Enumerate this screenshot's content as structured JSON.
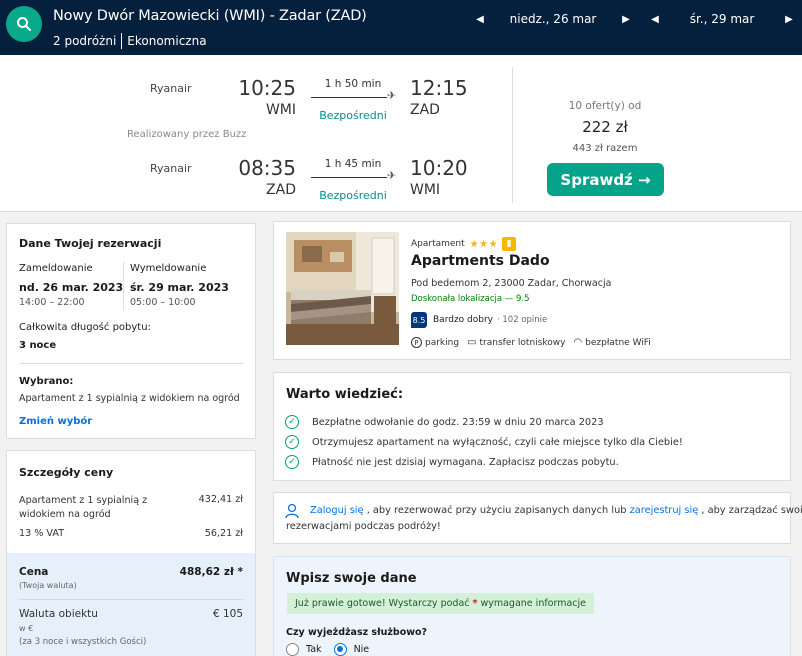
{
  "header": {
    "route": "Nowy Dwór Mazowiecki (WMI) - Zadar (ZAD)",
    "travellers": "2 podróżni",
    "cabin": "Ekonomiczna",
    "depart_date": "niedz., 26 mar",
    "return_date": "śr., 29 mar"
  },
  "flights": {
    "outbound": {
      "airline": "Ryanair",
      "dep_time": "10:25",
      "dep_code": "WMI",
      "duration": "1 h 50 min",
      "stops": "Bezpośredni",
      "arr_time": "12:15",
      "arr_code": "ZAD"
    },
    "operated_by": "Realizowany przez Buzz",
    "inbound": {
      "airline": "Ryanair",
      "dep_time": "08:35",
      "dep_code": "ZAD",
      "duration": "1 h 45 min",
      "stops": "Bezpośredni",
      "arr_time": "10:20",
      "arr_code": "WMI"
    },
    "offers": "10 ofert(y) od",
    "price": "222 zł",
    "price_total": "443 zł razem",
    "check_label": "Sprawdź →"
  },
  "reservation": {
    "title": "Dane Twojej rezerwacji",
    "checkin_label": "Zameldowanie",
    "checkin_date": "nd. 26 mar. 2023",
    "checkin_time": "14:00 – 22:00",
    "checkout_label": "Wymeldowanie",
    "checkout_date": "śr. 29 mar. 2023",
    "checkout_time": "05:00 – 10:00",
    "stay_label": "Całkowita długość pobytu:",
    "stay_value": "3 noce",
    "selected_label": "Wybrano:",
    "selected_value": "Apartament z 1 sypialnią z widokiem na ogród",
    "change_link": "Zmień wybór"
  },
  "price_details": {
    "title": "Szczegóły ceny",
    "item_label": "Apartament z 1 sypialnią z widokiem na ogród",
    "item_value": "432,41 zł",
    "vat_label": "13 % VAT",
    "vat_value": "56,21 zł",
    "total_label": "Cena",
    "total_value": "488,62 zł *",
    "total_note": "(Twoja waluta)",
    "property_currency_label": "Waluta obiektu",
    "property_currency_value": "€ 105",
    "property_currency_unit": "w €",
    "property_note": "(za 3 noce i wszystkich Gości)"
  },
  "hotel": {
    "type": "Apartament",
    "stars": "★★★",
    "name": "Apartments Dado",
    "address": "Pod bedemom 2, 23000 Zadar, Chorwacja",
    "location": "Doskonała lokalizacja — 9.5",
    "score": "8.5",
    "score_text": "Bardzo dobry",
    "reviews": "· 102 opinie",
    "amenities": [
      "parking",
      "transfer lotniskowy",
      "bezpłatne WiFi"
    ]
  },
  "good_to_know": {
    "title": "Warto wiedzieć:",
    "items": [
      "Bezpłatne odwołanie do godz. 23:59 w dniu 20 marca 2023",
      "Otrzymujesz apartament na wyłączność, czyli całe miejsce tylko dla Ciebie!",
      "Płatność nie jest dzisiaj wymagana. Zapłacisz podczas pobytu."
    ]
  },
  "login": {
    "link_login": "Zaloguj się",
    "text_middle": ", aby rezerwować przy użyciu zapisanych danych lub",
    "link_register": "zarejestruj się",
    "text_end": ", aby zarządzać swoimi",
    "text_line2": "rezerwacjami podczas podróży!"
  },
  "form": {
    "title": "Wpisz swoje dane",
    "notice_pre": "Już prawie gotowe! Wystarczy podać",
    "notice_star": "*",
    "notice_post": "wymagane informacje",
    "business_question": "Czy wyjeżdżasz służbowo?",
    "yes": "Tak",
    "no": "Nie"
  },
  "colors": {
    "header_bg": "#05203c",
    "accent": "#05a38a",
    "link": "#0770e3",
    "score_badge": "#003580"
  }
}
